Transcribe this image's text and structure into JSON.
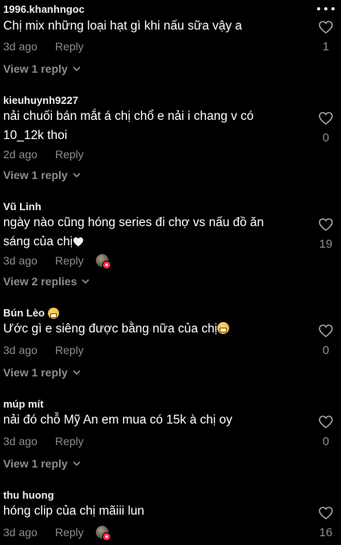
{
  "comments": [
    {
      "username": "1996.khanhngoc",
      "text": "Chị mix những loại hạt gì khi nấu sữa vậy a",
      "date": "3d ago",
      "reply_label": "Reply",
      "likes": "1",
      "view_replies": "View 1 reply"
    },
    {
      "username": "kieuhuynh9227",
      "text_line1": "nải chuối bán mắt á chị chổ e nải i chang v có",
      "text_line2": "10_12k thoi",
      "date": "2d ago",
      "reply_label": "Reply",
      "likes": "0",
      "view_replies": "View 1 reply"
    },
    {
      "username": "Vũ Linh",
      "text_line1": "ngày nào cũng hóng series đi chợ vs nấu đồ ăn",
      "text_line2": "sáng của chị",
      "text_emoji": "white-heart-icon",
      "date": "3d ago",
      "reply_label": "Reply",
      "likes": "19",
      "view_replies": "View 2 replies",
      "creator_liked": true
    },
    {
      "username": "Bún Lèo",
      "username_emoji": "grimacing-face-icon",
      "text": "Ước gì e siêng được bằng nữa của chị",
      "text_emoji": "grimacing-face-icon",
      "date": "3d ago",
      "reply_label": "Reply",
      "likes": "0",
      "view_replies": "View 1 reply"
    },
    {
      "username": "múp mít",
      "text": "nải đó chỗ Mỹ An em mua có 15k à chị oy",
      "date": "3d ago",
      "reply_label": "Reply",
      "likes": "0",
      "view_replies": "View 1 reply"
    },
    {
      "username": "thu huong",
      "text": "hóng clip của chị mãiii lun",
      "date": "3d ago",
      "reply_label": "Reply",
      "likes": "16",
      "creator_liked": true
    }
  ],
  "colors": {
    "background": "#000000",
    "text": "#ffffff",
    "muted": "#8d8d8d",
    "badge": "#fe2c55"
  }
}
